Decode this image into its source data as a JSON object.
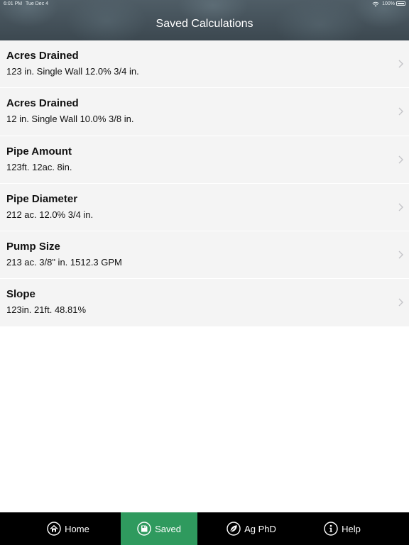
{
  "status_bar": {
    "time": "6:01 PM",
    "date": "Tue Dec 4",
    "battery": "100%"
  },
  "header": {
    "title": "Saved Calculations"
  },
  "saved_items": [
    {
      "title": "Acres Drained",
      "subtitle": "123 in. Single Wall 12.0% 3/4 in."
    },
    {
      "title": "Acres Drained",
      "subtitle": "12 in. Single Wall 10.0% 3/8 in."
    },
    {
      "title": "Pipe Amount",
      "subtitle": "123ft. 12ac. 8in."
    },
    {
      "title": "Pipe Diameter",
      "subtitle": "212 ac. 12.0% 3/4 in."
    },
    {
      "title": "Pump Size",
      "subtitle": "213 ac. 3/8\" in. 1512.3 GPM"
    },
    {
      "title": "Slope",
      "subtitle": "123in. 21ft. 48.81%"
    }
  ],
  "tabs": [
    {
      "label": "Home",
      "icon": "home-icon"
    },
    {
      "label": "Saved",
      "icon": "save-icon",
      "active": true
    },
    {
      "label": "Ag PhD",
      "icon": "leaf-icon"
    },
    {
      "label": "Help",
      "icon": "info-icon"
    }
  ],
  "colors": {
    "accent": "#2f9a5e",
    "header": "#46535c",
    "tabbar": "#000000",
    "row_bg": "#f4f4f4"
  }
}
